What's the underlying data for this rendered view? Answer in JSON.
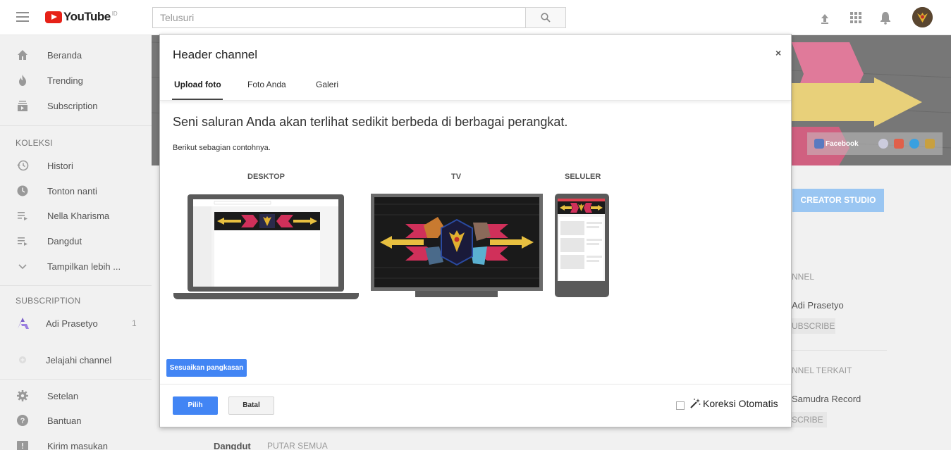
{
  "topbar": {
    "logo_text": "YouTube",
    "logo_region": "ID",
    "search_placeholder": "Telusuri"
  },
  "sidebar": {
    "items": [
      {
        "label": "Beranda",
        "icon": "home-icon"
      },
      {
        "label": "Trending",
        "icon": "flame-icon"
      },
      {
        "label": "Subscription",
        "icon": "subscriptions-icon"
      }
    ],
    "koleksi_heading": "KOLEKSI",
    "koleksi": [
      {
        "label": "Histori",
        "icon": "history-icon"
      },
      {
        "label": "Tonton nanti",
        "icon": "clock-icon"
      },
      {
        "label": "Nella Kharisma",
        "icon": "playlist-icon"
      },
      {
        "label": "Dangdut",
        "icon": "playlist-icon"
      },
      {
        "label": "Tampilkan lebih ...",
        "icon": "chevron-down-icon"
      }
    ],
    "subscription_heading": "SUBSCRIPTION",
    "subscriptions": [
      {
        "label": "Adi Prasetyo",
        "count": "1"
      }
    ],
    "browse_channels": "Jelajahi channel",
    "footer": [
      {
        "label": "Setelan",
        "icon": "gear-icon"
      },
      {
        "label": "Bantuan",
        "icon": "help-icon"
      },
      {
        "label": "Kirim masukan",
        "icon": "feedback-icon"
      }
    ]
  },
  "background": {
    "social_facebook": "Facebook",
    "creator_studio": "CREATOR STUDIO",
    "channel_heading": "NNEL",
    "channel_name": "Adi Prasetyo",
    "subscribe_1": "UBSCRIBE",
    "related_heading": "NNEL TERKAIT",
    "related_name": "Samudra Record",
    "subscribe_2": "SCRIBE",
    "playlist_title": "Dangdut",
    "play_all": "PUTAR SEMUA"
  },
  "modal": {
    "title": "Header channel",
    "close": "×",
    "tabs": [
      "Upload foto",
      "Foto Anda",
      "Galeri"
    ],
    "active_tab": "Upload foto",
    "lead": "Seni saluran Anda akan terlihat sedikit berbeda di berbagai perangkat.",
    "sub": "Berikut sebagian contohnya.",
    "device_labels": {
      "desktop": "DESKTOP",
      "tv": "TV",
      "mobile": "SELULER"
    },
    "crop_button": "Sesuaikan pangkasan",
    "select_button": "Pilih",
    "cancel_button": "Batal",
    "auto_correct_label": "Koreksi Otomatis",
    "auto_correct_checked": false
  },
  "colors": {
    "accent_blue": "#4285f4",
    "youtube_red": "#e62117",
    "creator_blue": "#9ac6f2"
  }
}
